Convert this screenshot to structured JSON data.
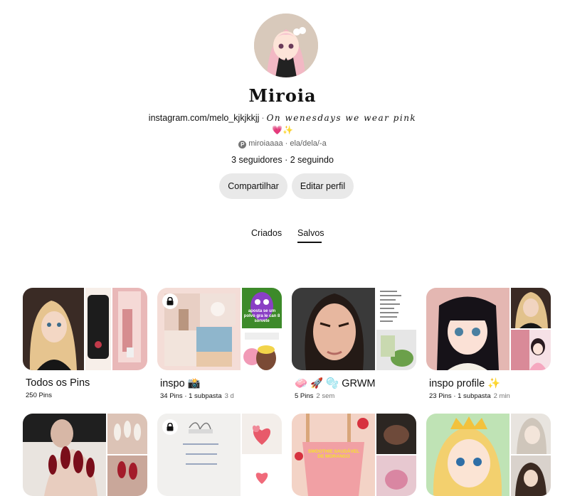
{
  "profile": {
    "name": "Miroia",
    "link": "instagram.com/melo_kjkjkkjj",
    "quote": "On wenesdays we wear pink",
    "emojis": "💗✨",
    "username_line": "miroiaaaa · ela/dela/-a",
    "follow_stats": "3 seguidores · 2 seguindo"
  },
  "actions": {
    "share_label": "Compartilhar",
    "edit_label": "Editar perfil"
  },
  "tabs": [
    {
      "label": "Criados",
      "active": false
    },
    {
      "label": "Salvos",
      "active": true
    }
  ],
  "boards": [
    {
      "title": "Todos os Pins",
      "meta": "250 Pins",
      "time": "",
      "locked": false
    },
    {
      "title": "inspo 📸",
      "meta": "34 Pins · 1 subpasta",
      "time": "3 d",
      "locked": true,
      "overlay": "aposta se um polvo gra le can 8 sorvete"
    },
    {
      "title": "🧼 🚀 🫧 GRWM",
      "meta": "5 Pins",
      "time": "2 sem",
      "locked": false
    },
    {
      "title": "inspo profile ✨",
      "meta": "23 Pins · 1 subpasta",
      "time": "2 min",
      "locked": false
    },
    {
      "title": "",
      "meta": "",
      "time": "",
      "locked": false
    },
    {
      "title": "",
      "meta": "",
      "time": "",
      "locked": true
    },
    {
      "title": "",
      "meta": "",
      "time": "",
      "locked": false,
      "overlay": "SMOOTHIE SAUDÁVEL DE MORANGO"
    },
    {
      "title": "",
      "meta": "",
      "time": "",
      "locked": false
    }
  ],
  "colors": {
    "button_bg": "#e9e9e9",
    "accent_pink": "#e85a8a",
    "text": "#111111",
    "muted": "#767676"
  }
}
